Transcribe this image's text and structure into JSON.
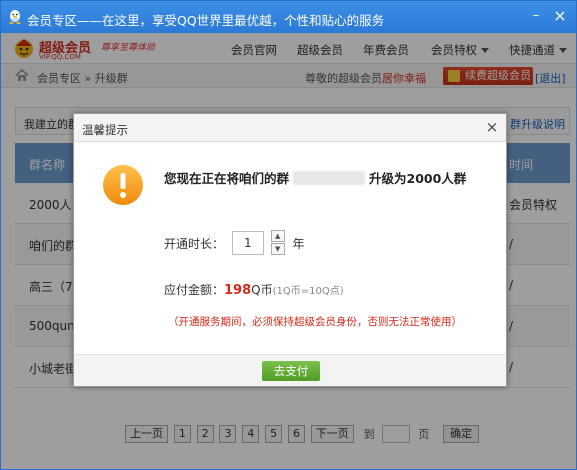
{
  "window": {
    "title": "会员专区——在这里，享受QQ世界里最优越，个性和贴心的服务",
    "minimize_glyph": "–",
    "close_glyph": "×"
  },
  "nav": {
    "logo_text": "超级会员",
    "logo_sub": "VIP.QQ.COM",
    "logo_slogan": "尊享至尊体验",
    "items": [
      {
        "label": "会员官网"
      },
      {
        "label": "超级会员"
      },
      {
        "label": "年费会员"
      },
      {
        "label": "会员特权"
      },
      {
        "label": "快捷通道"
      }
    ]
  },
  "crumb": {
    "path": "会员专区 » 升级群",
    "greeting_prefix": "尊敬的超级会员",
    "greeting_highlight": "居你幸福",
    "renew_label": "续费超级会员",
    "logout_label": "[退出]"
  },
  "content": {
    "info_text": "我建立的群",
    "info_link": "群升级说明",
    "table": {
      "col_name": "群名称",
      "col_tail": "时间",
      "rows": [
        {
          "name": "2000人",
          "tail": "会员特权"
        },
        {
          "name": "咱们的群",
          "tail": "/"
        },
        {
          "name": "高三（7",
          "tail": "/"
        },
        {
          "name": "500qun",
          "tail": "/"
        },
        {
          "name": "小城老街",
          "tail": "/"
        }
      ]
    }
  },
  "pager": {
    "prev": "上一页",
    "pages": [
      "1",
      "2",
      "3",
      "4",
      "5",
      "6"
    ],
    "next": "下一页",
    "goto_prefix": "到",
    "goto_suffix": "页",
    "confirm": "确定"
  },
  "modal": {
    "title": "温馨提示",
    "close_glyph": "×",
    "message_before": "您现在正在将咱们的群",
    "message_after": "升级为2000人群",
    "duration_label": "开通时长：",
    "duration_value": "1",
    "duration_unit": "年",
    "price_label": "应付金额：",
    "price_amount": "198",
    "price_currency": "Q币",
    "price_rate": "(1Q币=10Q点)",
    "note": "（开通服务期间，必须保持超级会员身份，否则无法正常使用）",
    "pay_button": "去支付"
  },
  "colors": {
    "titlebar": "#2b79d6",
    "accent_red": "#d32a1a",
    "pay_green": "#4f9b24",
    "table_header": "#6c9bd1"
  }
}
